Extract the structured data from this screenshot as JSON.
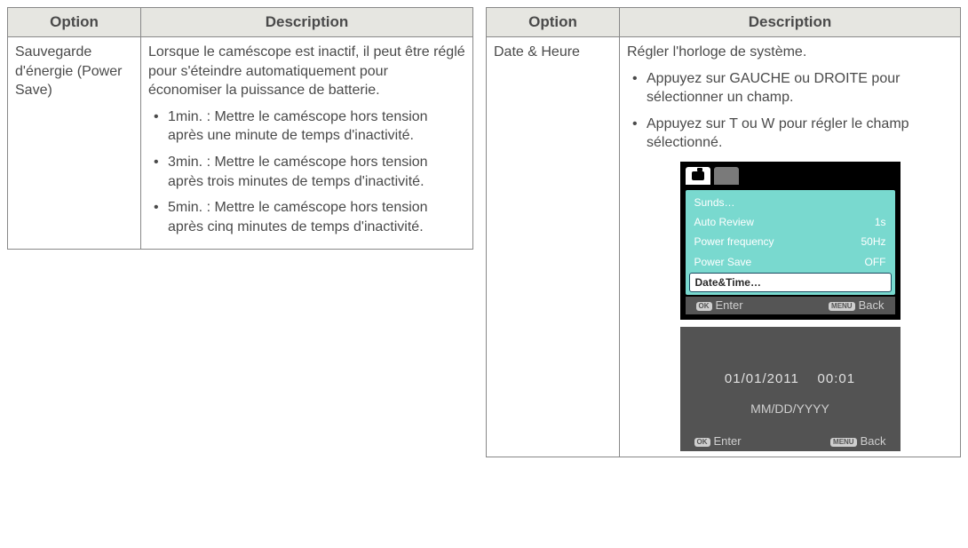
{
  "headers": {
    "option": "Option",
    "description": "Description"
  },
  "left": {
    "option": "Sauvegarde d'énergie (Power Save)",
    "intro": "Lorsque le caméscope est inactif, il peut être réglé pour s'éteindre automatiquement pour économiser la puissance de batterie.",
    "bullets": [
      "1min. : Mettre le caméscope hors tension après une minute de temps d'inactivité.",
      "3min. : Mettre le caméscope hors tension après trois minutes de temps d'inactivité.",
      "5min. : Mettre le caméscope hors tension après cinq minutes de temps d'inactivité."
    ]
  },
  "right": {
    "option": "Date & Heure",
    "intro": "Régler l'horloge de système.",
    "bullets": [
      "Appuyez sur GAUCHE ou DROITE pour sélectionner un champ.",
      "Appuyez sur T ou W pour régler le champ sélectionné."
    ]
  },
  "menu": {
    "items": [
      {
        "label": "Sunds…",
        "value": ""
      },
      {
        "label": "Auto Review",
        "value": "1s"
      },
      {
        "label": "Power frequency",
        "value": "50Hz"
      },
      {
        "label": "Power Save",
        "value": "OFF"
      },
      {
        "label": "Date&Time…",
        "value": ""
      }
    ],
    "enter": "Enter",
    "back": "Back",
    "ok": "OK",
    "menuBtn": "MENU"
  },
  "datescreen": {
    "date": "01/01/2011",
    "time": "00:01",
    "format": "MM/DD/YYYY",
    "enter": "Enter",
    "back": "Back",
    "ok": "OK",
    "menuBtn": "MENU"
  }
}
